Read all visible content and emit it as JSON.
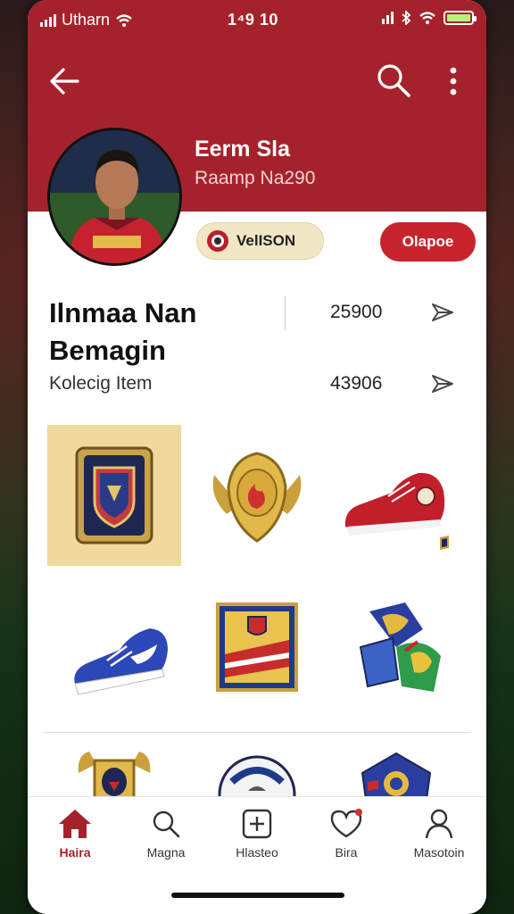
{
  "status": {
    "carrier": "Utharn",
    "time": "1⁴9 10"
  },
  "profile": {
    "name": "Eerm Sla",
    "subtitle": "Raamp Na290",
    "club_label": "VelISON",
    "action_label": "Olapoe"
  },
  "summary": {
    "title_line1": "Ilnmaa Nan",
    "title_line2": "Bemagin",
    "collection_label": "Kolecig Item",
    "stat1": "25900",
    "stat2": "43906"
  },
  "items": [
    {
      "icon": "crest-shield-icon"
    },
    {
      "icon": "gold-badge-icon"
    },
    {
      "icon": "red-sneaker-icon"
    },
    {
      "icon": "blue-sneaker-icon"
    },
    {
      "icon": "flag-emblem-icon"
    },
    {
      "icon": "parrot-kit-icon"
    },
    {
      "icon": "gold-crest-icon"
    },
    {
      "icon": "football-icon"
    },
    {
      "icon": "blue-shield-icon"
    }
  ],
  "nav": {
    "items": [
      {
        "label": "Haira",
        "icon": "home-icon",
        "active": true
      },
      {
        "label": "Magna",
        "icon": "search-icon",
        "active": false
      },
      {
        "label": "Hlasteo",
        "icon": "add-icon",
        "active": false
      },
      {
        "label": "Bira",
        "icon": "heart-icon",
        "active": false
      },
      {
        "label": "Masotoin",
        "icon": "profile-icon",
        "active": false
      }
    ]
  },
  "colors": {
    "brand_red": "#a5222c",
    "action_red": "#c8242e",
    "badge_cream": "#f2e7c4"
  }
}
